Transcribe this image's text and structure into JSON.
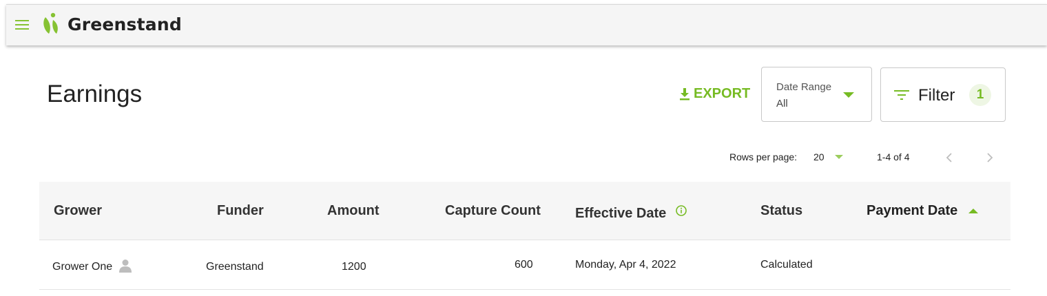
{
  "app": {
    "brand": "Greenstand"
  },
  "page": {
    "title": "Earnings"
  },
  "toolbar": {
    "export_label": "EXPORT",
    "date_range": {
      "label": "Date Range",
      "value": "All"
    },
    "filter": {
      "label": "Filter",
      "count": "1"
    }
  },
  "pagination": {
    "rows_per_page_label": "Rows per page:",
    "rows_per_page_value": "20",
    "range_text": "1-4 of 4"
  },
  "table": {
    "columns": [
      "Grower",
      "Funder",
      "Amount",
      "Capture Count",
      "Effective Date",
      "Status",
      "Payment Date"
    ],
    "rows": [
      {
        "grower": "Grower One",
        "funder": "Greenstand",
        "amount": "1200",
        "capture_count": "600",
        "effective_date": "Monday, Apr 4, 2022",
        "status": "Calculated",
        "payment_date": ""
      }
    ],
    "sorted_column": "Payment Date",
    "sort_direction": "ascending"
  },
  "colors": {
    "accent": "#76bb23",
    "header_bg": "#f5f5f5",
    "table_header_bg": "#f6f6f6"
  },
  "icons": [
    "menu-icon",
    "greenstand-logo-icon",
    "download-icon",
    "chevron-down-icon",
    "filter-icon",
    "chevron-left-icon",
    "chevron-right-icon",
    "info-icon",
    "sort-ascending-icon",
    "person-icon"
  ]
}
